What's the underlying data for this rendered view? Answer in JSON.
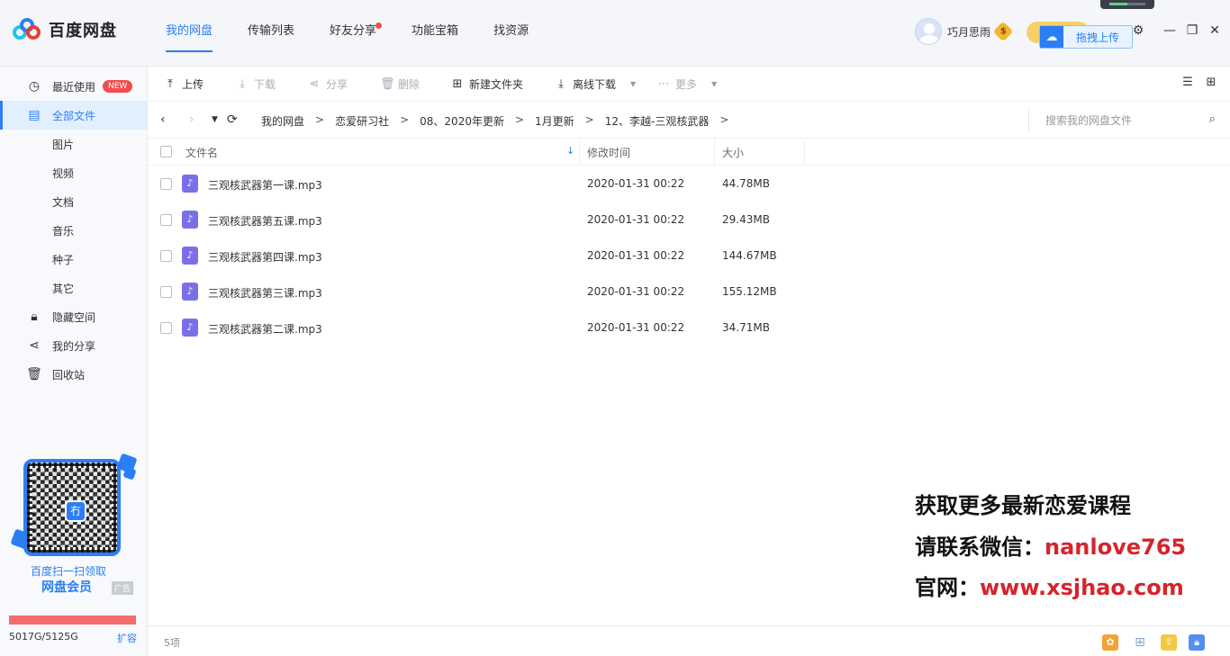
{
  "app": {
    "name": "百度网盘"
  },
  "nav": {
    "items": [
      {
        "label": "我的网盘",
        "active": true
      },
      {
        "label": "传输列表",
        "active": false
      },
      {
        "label": "好友分享",
        "active": false,
        "dot": true
      },
      {
        "label": "功能宝箱",
        "active": false
      },
      {
        "label": "找资源",
        "active": false
      }
    ]
  },
  "user": {
    "name": "巧月思雨",
    "vip_symbol": "$"
  },
  "drag_upload": {
    "label": "拖拽上传"
  },
  "window_controls": {
    "settings": "⚙",
    "minimize": "—",
    "restore": "❐",
    "close": "✕"
  },
  "sidebar": {
    "items": [
      {
        "label": "最近使用",
        "icon": "clock-icon",
        "badge": "NEW"
      },
      {
        "label": "全部文件",
        "icon": "document-icon",
        "active": true
      },
      {
        "label": "图片"
      },
      {
        "label": "视频"
      },
      {
        "label": "文档"
      },
      {
        "label": "音乐"
      },
      {
        "label": "种子"
      },
      {
        "label": "其它"
      },
      {
        "label": "隐藏空间",
        "icon": "lock-icon"
      },
      {
        "label": "我的分享",
        "icon": "share-icon"
      },
      {
        "label": "回收站",
        "icon": "trash-icon"
      }
    ],
    "promo": {
      "line1": "百度扫一扫领取",
      "line2": "网盘会员",
      "ad_tag": "广告",
      "qr_center": "冇"
    },
    "storage": {
      "text": "5017G/5125G",
      "used_fraction": 0.979,
      "expand_label": "扩容"
    }
  },
  "toolbar": {
    "upload": "上传",
    "download": "下载",
    "share": "分享",
    "delete": "删除",
    "new_folder": "新建文件夹",
    "offline_download": "离线下载",
    "more": "更多"
  },
  "breadcrumb": {
    "items": [
      "我的网盘",
      "恋爱研习社",
      "08、2020年更新",
      "1月更新",
      "12、李越-三观核武器"
    ],
    "separator": ">"
  },
  "search": {
    "placeholder": "搜索我的网盘文件"
  },
  "table": {
    "headers": {
      "name": "文件名",
      "modified": "修改时间",
      "size": "大小"
    },
    "rows": [
      {
        "name": "三观核武器第一课.mp3",
        "modified": "2020-01-31 00:22",
        "size": "44.78MB"
      },
      {
        "name": "三观核武器第五课.mp3",
        "modified": "2020-01-31 00:22",
        "size": "29.43MB"
      },
      {
        "name": "三观核武器第四课.mp3",
        "modified": "2020-01-31 00:22",
        "size": "144.67MB"
      },
      {
        "name": "三观核武器第三课.mp3",
        "modified": "2020-01-31 00:22",
        "size": "155.12MB"
      },
      {
        "name": "三观核武器第二课.mp3",
        "modified": "2020-01-31 00:22",
        "size": "34.71MB"
      }
    ]
  },
  "watermark": {
    "line1": "获取更多最新恋爱课程",
    "line2_prefix": "请联系微信：",
    "line2_value": "nanlove765",
    "line3_prefix": "官网：",
    "line3_value": "www.xsjhao.com"
  },
  "status": {
    "count": "5项"
  },
  "colors": {
    "accent": "#2b7ef5",
    "danger": "#f44c4c",
    "file_audio": "#7b6fe8"
  }
}
